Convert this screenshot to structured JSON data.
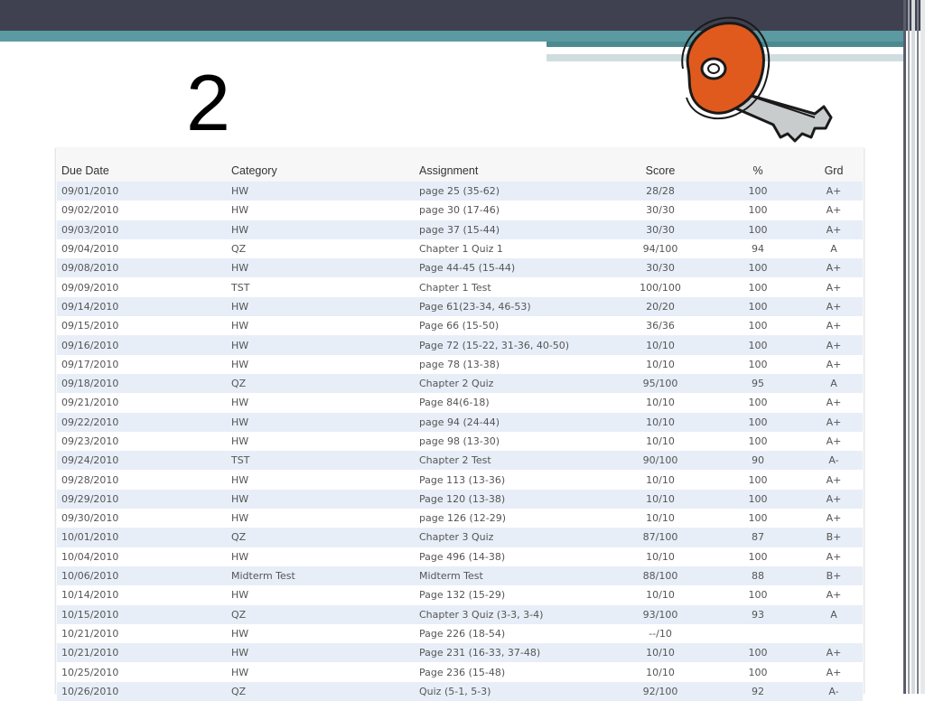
{
  "slide": {
    "number": "2"
  },
  "table": {
    "headers": {
      "due_date": "Due Date",
      "category": "Category",
      "assignment": "Assignment",
      "score": "Score",
      "percent": "%",
      "grade": "Grd"
    },
    "rows": [
      [
        "09/01/2010",
        "HW",
        "page 25 (35-62)",
        "28/28",
        "100",
        "A+"
      ],
      [
        "09/02/2010",
        "HW",
        "page 30 (17-46)",
        "30/30",
        "100",
        "A+"
      ],
      [
        "09/03/2010",
        "HW",
        "page 37 (15-44)",
        "30/30",
        "100",
        "A+"
      ],
      [
        "09/04/2010",
        "QZ",
        "Chapter 1 Quiz 1",
        "94/100",
        "94",
        "A"
      ],
      [
        "09/08/2010",
        "HW",
        "Page 44-45 (15-44)",
        "30/30",
        "100",
        "A+"
      ],
      [
        "09/09/2010",
        "TST",
        "Chapter 1 Test",
        "100/100",
        "100",
        "A+"
      ],
      [
        "09/14/2010",
        "HW",
        "Page 61(23-34, 46-53)",
        "20/20",
        "100",
        "A+"
      ],
      [
        "09/15/2010",
        "HW",
        "Page 66 (15-50)",
        "36/36",
        "100",
        "A+"
      ],
      [
        "09/16/2010",
        "HW",
        "Page 72 (15-22, 31-36, 40-50)",
        "10/10",
        "100",
        "A+"
      ],
      [
        "09/17/2010",
        "HW",
        "page 78 (13-38)",
        "10/10",
        "100",
        "A+"
      ],
      [
        "09/18/2010",
        "QZ",
        "Chapter 2 Quiz",
        "95/100",
        "95",
        "A"
      ],
      [
        "09/21/2010",
        "HW",
        "Page 84(6-18)",
        "10/10",
        "100",
        "A+"
      ],
      [
        "09/22/2010",
        "HW",
        "page 94 (24-44)",
        "10/10",
        "100",
        "A+"
      ],
      [
        "09/23/2010",
        "HW",
        "page 98 (13-30)",
        "10/10",
        "100",
        "A+"
      ],
      [
        "09/24/2010",
        "TST",
        "Chapter 2 Test",
        "90/100",
        "90",
        "A-"
      ],
      [
        "09/28/2010",
        "HW",
        "Page 113 (13-36)",
        "10/10",
        "100",
        "A+"
      ],
      [
        "09/29/2010",
        "HW",
        "Page 120 (13-38)",
        "10/10",
        "100",
        "A+"
      ],
      [
        "09/30/2010",
        "HW",
        "page 126 (12-29)",
        "10/10",
        "100",
        "A+"
      ],
      [
        "10/01/2010",
        "QZ",
        "Chapter 3 Quiz",
        "87/100",
        "87",
        "B+"
      ],
      [
        "10/04/2010",
        "HW",
        "Page 496 (14-38)",
        "10/10",
        "100",
        "A+"
      ],
      [
        "10/06/2010",
        "Midterm Test",
        "Midterm Test",
        "88/100",
        "88",
        "B+"
      ],
      [
        "10/14/2010",
        "HW",
        "Page 132 (15-29)",
        "10/10",
        "100",
        "A+"
      ],
      [
        "10/15/2010",
        "QZ",
        "Chapter 3 Quiz (3-3, 3-4)",
        "93/100",
        "93",
        "A"
      ],
      [
        "10/21/2010",
        "HW",
        "Page 226 (18-54)",
        "--/10",
        "",
        ""
      ],
      [
        "10/21/2010",
        "HW",
        "Page 231 (16-33, 37-48)",
        "10/10",
        "100",
        "A+"
      ],
      [
        "10/25/2010",
        "HW",
        "Page 236 (15-48)",
        "10/10",
        "100",
        "A+"
      ],
      [
        "10/26/2010",
        "QZ",
        "Quiz (5-1, 5-3)",
        "92/100",
        "92",
        "A-"
      ]
    ]
  },
  "colors": {
    "top_bar": "#3f4151",
    "teal_band": "#5a9aa0",
    "key_orange": "#e05a1e",
    "key_gray": "#c9cccd",
    "row_alt": "#e8eef8"
  },
  "icons": {
    "decoration": "key-icon"
  }
}
